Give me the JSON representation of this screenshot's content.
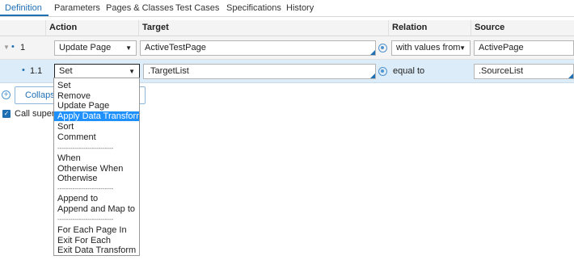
{
  "tabs": [
    {
      "label": "Definition",
      "active": true
    },
    {
      "label": "Parameters"
    },
    {
      "label": "Pages & Classes"
    },
    {
      "label": "Test Cases"
    },
    {
      "label": "Specifications"
    },
    {
      "label": "History"
    }
  ],
  "grid": {
    "headers": {
      "action": "Action",
      "target": "Target",
      "relation": "Relation",
      "source": "Source"
    },
    "rows": [
      {
        "seq": "1",
        "action": "Update Page",
        "target": "ActiveTestPage",
        "relation": "with values from",
        "source": "ActivePage",
        "expanded": true
      },
      {
        "seq": "1.1",
        "action": "Set",
        "target": ".TargetList",
        "relation": "equal to",
        "source": ".SourceList",
        "selected": true
      }
    ]
  },
  "collapse_label": "Collapse All",
  "call_superclass_label": "Call superclass data transform",
  "dropdown": {
    "options": [
      "Set",
      "Remove",
      "Update Page",
      "Apply Data Transform",
      "Sort",
      "Comment",
      "--------------------------",
      "When",
      "Otherwise When",
      "Otherwise",
      "--------------------------",
      "Append to",
      "Append and Map to",
      "--------------------------",
      "For Each Page In",
      "Exit For Each",
      "Exit Data Transform"
    ],
    "highlighted": "Apply Data Transform"
  },
  "colors": {
    "accent": "#1f6fb3",
    "highlight": "#1e90ff",
    "selected_row": "#dcecf8"
  },
  "icons": [
    "chevron-down-icon",
    "expand-triangle-icon",
    "bullet-icon",
    "target-picker-icon",
    "add-circle-icon",
    "checkbox-checked-icon"
  ]
}
